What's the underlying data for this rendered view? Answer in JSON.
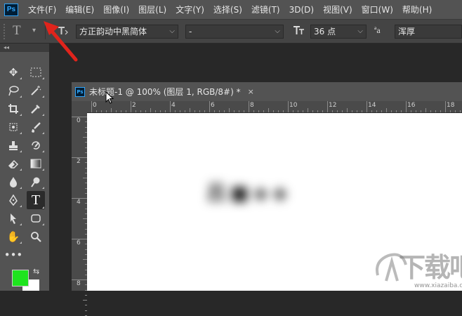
{
  "menubar": {
    "logo": "Ps",
    "items": [
      "文件(F)",
      "编辑(E)",
      "图像(I)",
      "图层(L)",
      "文字(Y)",
      "选择(S)",
      "滤镜(T)",
      "3D(D)",
      "视图(V)",
      "窗口(W)",
      "帮助(H)"
    ]
  },
  "options": {
    "tool_glyph": "T",
    "font_family": "方正韵动中黑简体",
    "font_style": "-",
    "font_size": "36 点",
    "aa_label": "a",
    "antialias": "浑厚"
  },
  "toolbar": {
    "collapse": "◂◂"
  },
  "document": {
    "logo": "Ps",
    "title": "未标题-1 @ 100% (图层 1, RGB/8#) *",
    "close": "×",
    "ruler_h": [
      "0",
      "2",
      "4",
      "6",
      "8",
      "10",
      "12",
      "14",
      "16",
      "18"
    ],
    "ruler_v": [
      "0",
      "2",
      "4",
      "6",
      "8"
    ]
  },
  "canvas_text": "吕■◈◈",
  "colors": {
    "foreground": "#1ee41e",
    "background": "#ffffff",
    "accent": "#31a8ff",
    "annotation_arrow": "#e0241c"
  },
  "watermark": {
    "text": "下载吧",
    "url": "www.xiazaiba.com"
  }
}
